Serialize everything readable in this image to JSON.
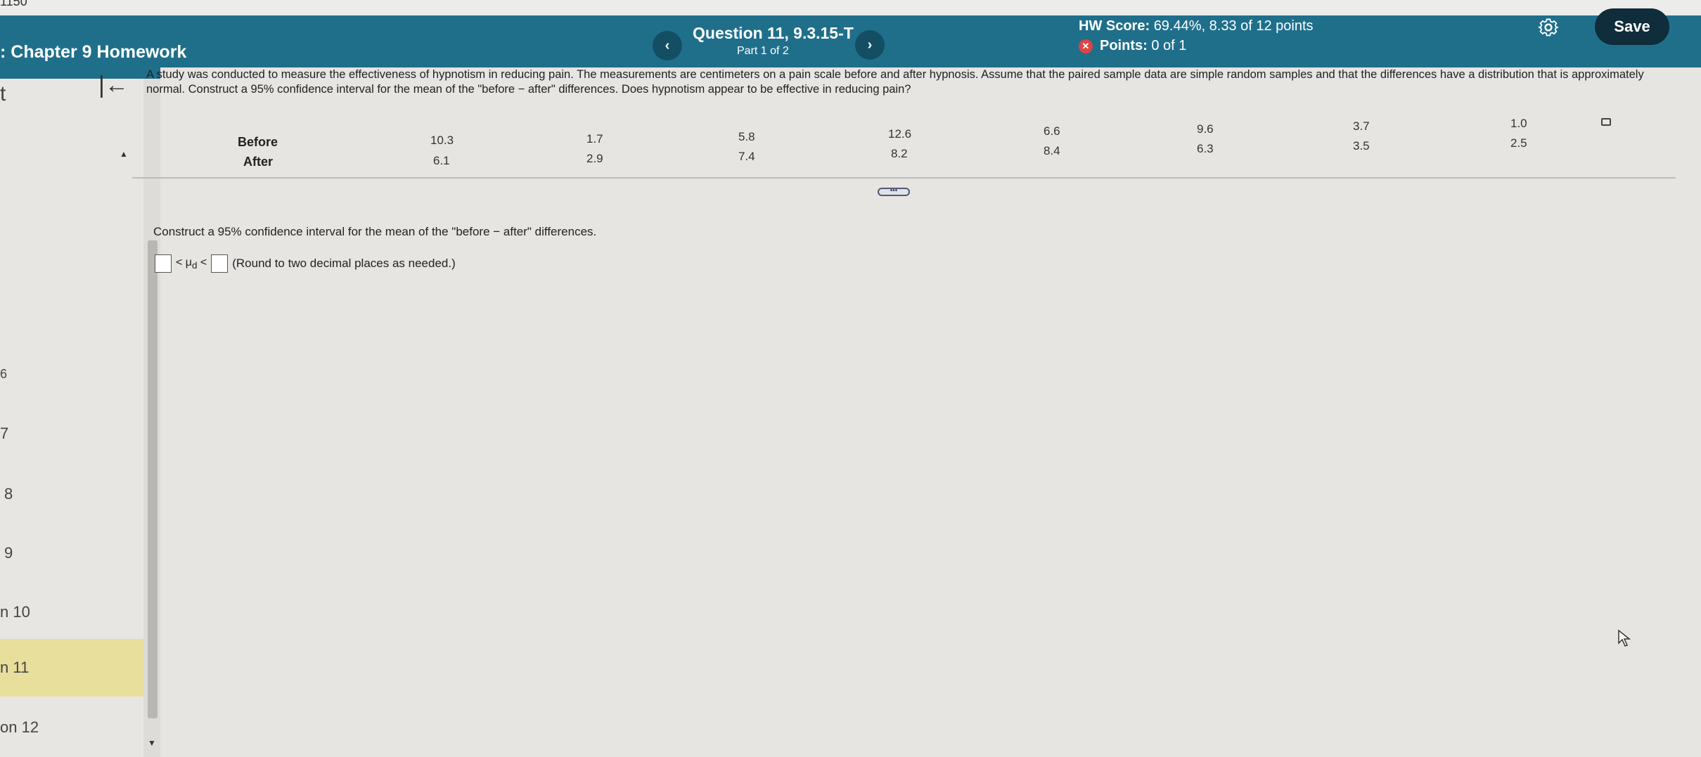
{
  "top": {
    "partial_text": "1150"
  },
  "header": {
    "title": ": Chapter 9 Homework",
    "prev_icon": "chevron-left-icon",
    "next_icon": "chevron-right-icon",
    "prev_symbol": "‹",
    "next_symbol": "›",
    "question_title": "Question 11, 9.3.15-T",
    "question_part": "Part 1 of 2",
    "hw_score_label": "HW Score:",
    "hw_score_value": "69.44%, 8.33 of 12 points",
    "points_label": "Points:",
    "points_value": "0 of 1",
    "points_icon": "x-circle-icon",
    "points_icon_symbol": "✕",
    "gear_icon": "gear-icon",
    "save_label": "Save"
  },
  "sidebar": {
    "items": [
      {
        "label": "t"
      },
      {
        "label": "6"
      },
      {
        "label": "7"
      },
      {
        "label": "8"
      },
      {
        "label": "9"
      },
      {
        "label": "n 10"
      },
      {
        "label": "n 11"
      },
      {
        "label": "on 12"
      }
    ],
    "active_index": 6
  },
  "main": {
    "collapse_symbol": "|←",
    "problem_text": "A study was conducted to measure the effectiveness of hypnotism in reducing pain. The measurements are centimeters on a pain scale before and after hypnosis. Assume that the paired sample data are simple random samples and that the differences have a distribution that is approximately normal. Construct a 95% confidence interval for the mean of the \"before − after\" differences. Does hypnotism appear to be effective in reducing pain?",
    "table": {
      "rows": [
        {
          "label": "Before",
          "values": [
            "10.3",
            "1.7",
            "5.8",
            "12.6",
            "6.6",
            "9.6",
            "3.7",
            "1.0"
          ]
        },
        {
          "label": "After",
          "values": [
            "6.1",
            "2.9",
            "7.4",
            "8.2",
            "8.4",
            "6.3",
            "3.5",
            "2.5"
          ]
        }
      ]
    },
    "more_label": "•••",
    "prompt": "Construct a 95% confidence interval for the mean of the \"before − after\" differences.",
    "answer": {
      "lower_value": "",
      "upper_value": "",
      "less_than": "<",
      "mu": "μ",
      "mu_sub": "d",
      "note": "(Round to two decimal places as needed.)"
    }
  }
}
